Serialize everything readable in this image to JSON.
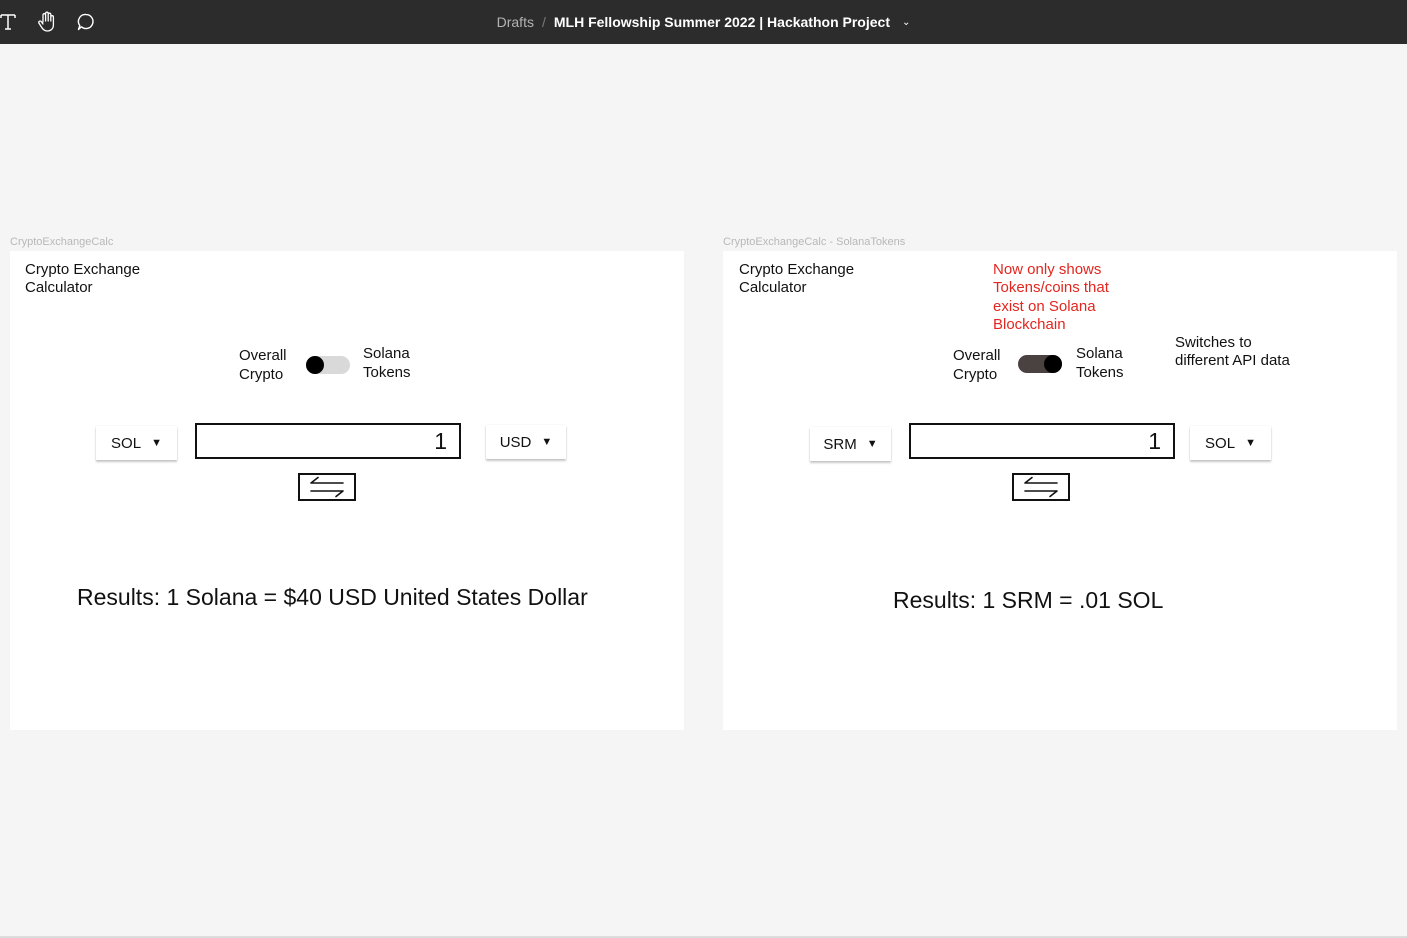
{
  "topbar": {
    "breadcrumb_root": "Drafts",
    "separator": "/",
    "file_name": "MLH Fellowship Summer 2022 | Hackathon Project",
    "tools": [
      "text-tool-icon",
      "hand-tool-icon",
      "comment-tool-icon"
    ]
  },
  "frames": [
    {
      "label": "CryptoExchangeCalc",
      "title": "Crypto Exchange\nCalculator",
      "toggle_left": "Overall\nCrypto",
      "toggle_right": "Solana\nTokens",
      "toggle_on": false,
      "from_currency": "SOL",
      "amount": "1",
      "to_currency": "USD",
      "result": "Results: 1 Solana = $40 USD United States Dollar"
    },
    {
      "label": "CryptoExchangeCalc - SolanaTokens",
      "title": "Crypto Exchange\nCalculator",
      "note_red": "Now only shows\nTokens/coins that\nexist on Solana\nBlockchain",
      "note_black": "Switches to\ndifferent API data",
      "toggle_left": "Overall\nCrypto",
      "toggle_right": "Solana\nTokens",
      "toggle_on": true,
      "from_currency": "SRM",
      "amount": "1",
      "to_currency": "SOL",
      "result": "Results: 1 SRM = .01 SOL"
    }
  ],
  "colors": {
    "topbar": "#2c2c2c",
    "canvas": "#f5f5f5",
    "annotation_red": "#e3261f",
    "toggle_on": "#4a4141",
    "toggle_off": "#d9d9d9"
  }
}
